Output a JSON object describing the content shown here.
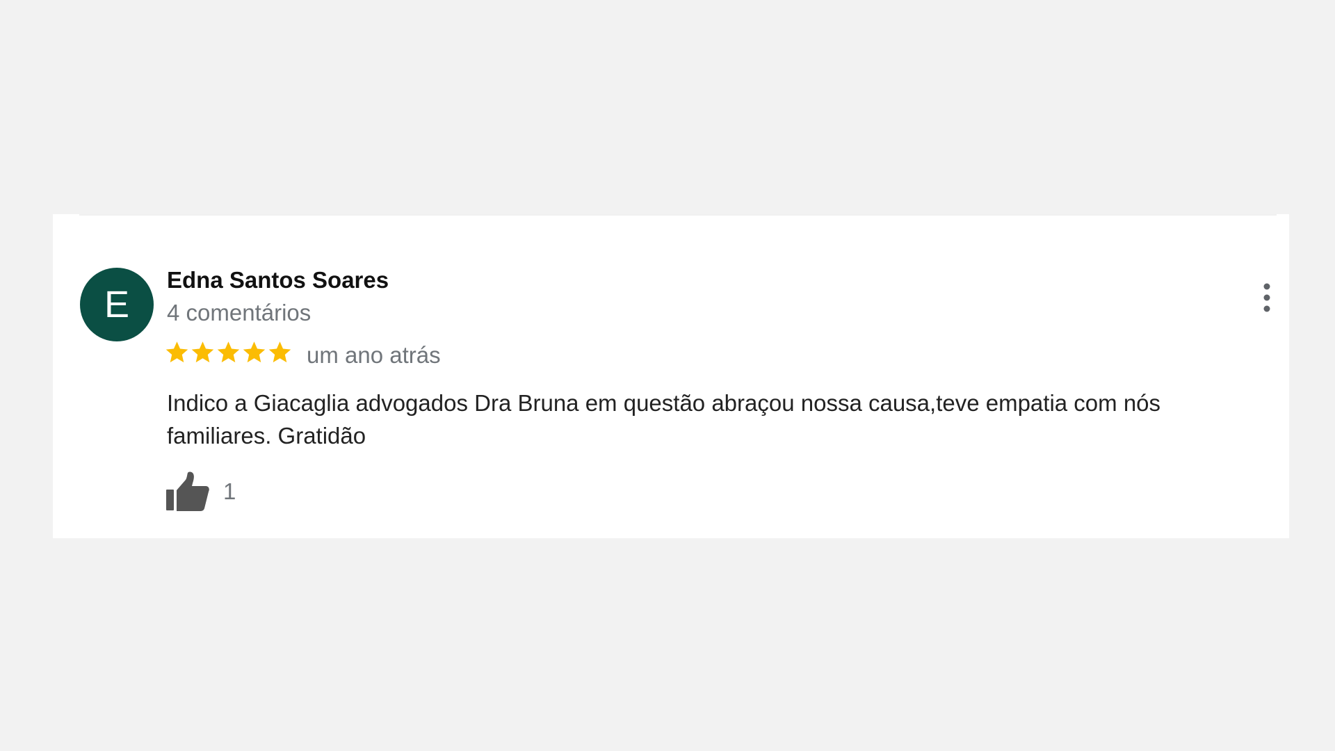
{
  "review": {
    "avatar_letter": "E",
    "avatar_color": "#0b4f44",
    "author_name": "Edna Santos Soares",
    "author_review_count": "4 comentários",
    "rating": 5,
    "rating_max": 5,
    "star_color": "#fbbc04",
    "date": "um ano atrás",
    "text": "Indico a Giacaglia advogados Dra Bruna em questão abraçou nossa causa,teve empatia com nós familiares. Gratidão",
    "likes": "1",
    "icons": {
      "like": "thumbs-up-icon",
      "more": "more-vert-icon",
      "star": "star-icon"
    }
  }
}
